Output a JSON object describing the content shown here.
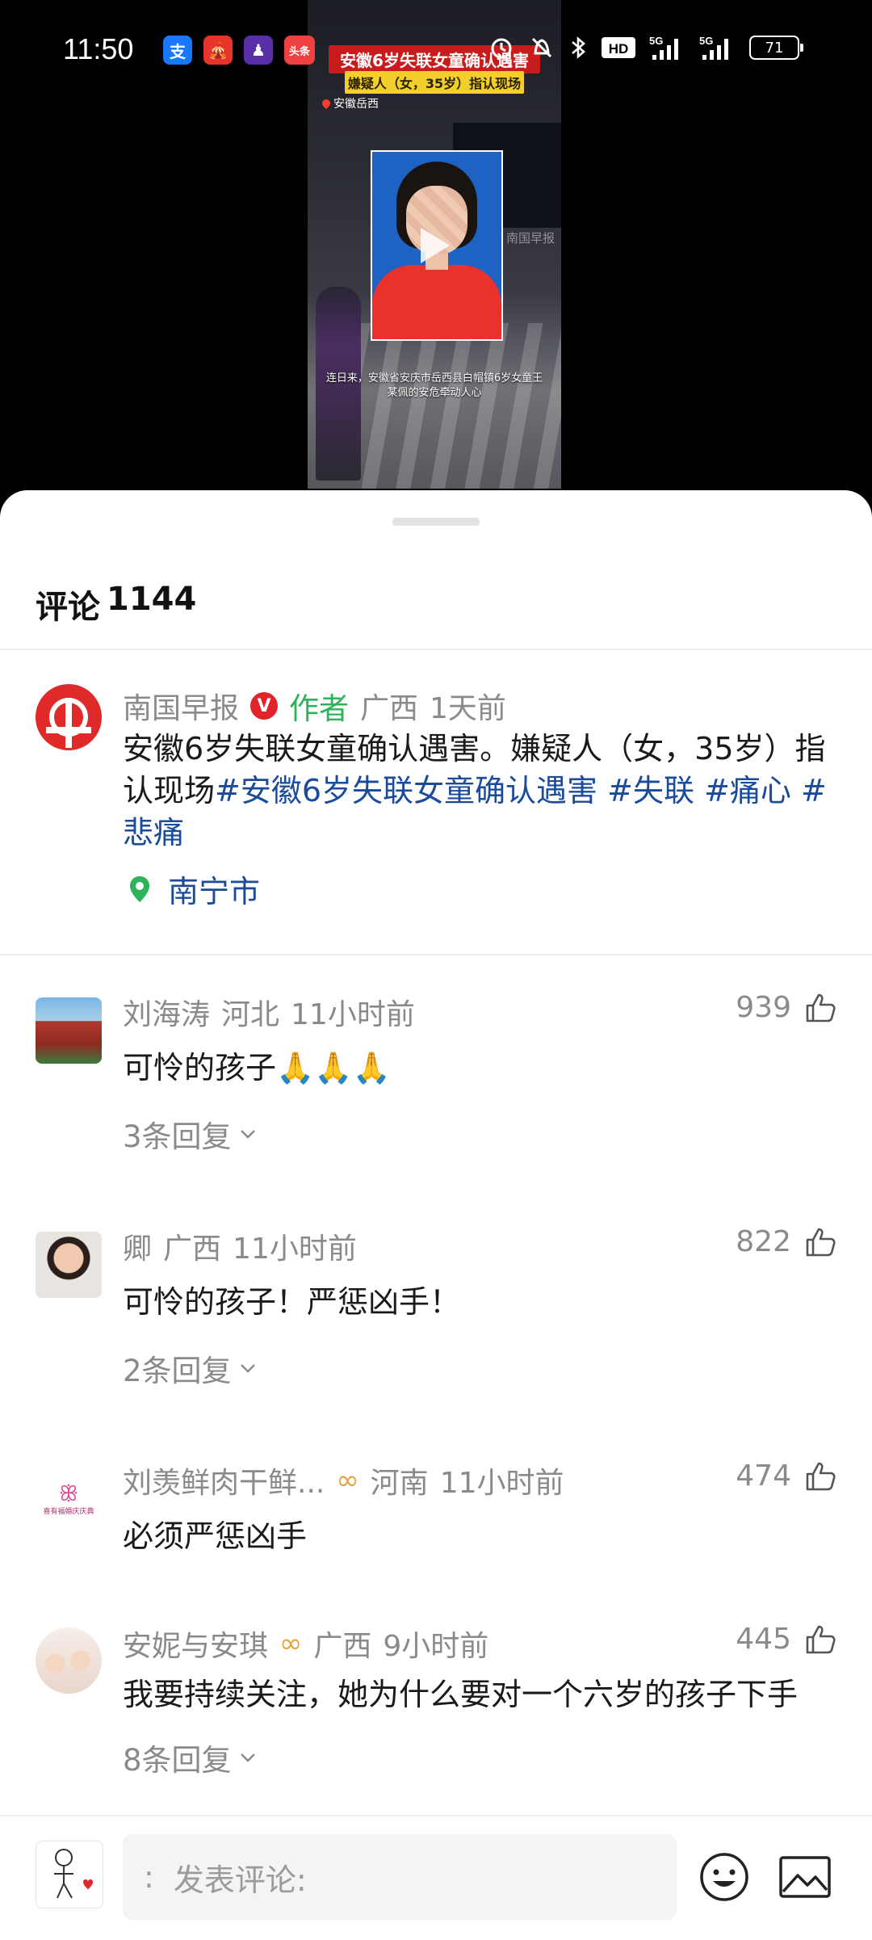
{
  "status_bar": {
    "time": "11:50",
    "apps": [
      "支",
      "🎪",
      "♟",
      "头条"
    ],
    "network_1": "5G",
    "network_2": "5G",
    "hd_label": "HD",
    "battery": "71"
  },
  "video": {
    "title": "安徽6岁失联女童确认遇害",
    "subtitle": "嫌疑人（女，35岁）指认现场",
    "location": "安徽岳西",
    "watermark": "南国早报",
    "caption": "连日来，安徽省安庆市岳西县白帽镇6岁女童王某佩的安危牵动人心"
  },
  "sheet": {
    "title_label": "评论",
    "count": "1144"
  },
  "post": {
    "author": "南国早报",
    "verified_badge": "V",
    "author_tag": "作者",
    "region": "广西",
    "time": "1天前",
    "text": "安徽6岁失联女童确认遇害。嫌疑人（女，35岁）指认现场",
    "hashtags": [
      "#安徽6岁失联女童确认遇害",
      "#失联",
      "#痛心",
      "#悲痛"
    ],
    "location": "南宁市"
  },
  "comments": [
    {
      "user": "刘海涛",
      "region": "河北",
      "time": "11小时前",
      "text": "可怜的孩子🙏🙏🙏",
      "likes": "939",
      "replies": "3条回复"
    },
    {
      "user": "卿",
      "region": "广西",
      "time": "11小时前",
      "text": "可怜的孩子！严惩凶手！",
      "likes": "822",
      "replies": "2条回复"
    },
    {
      "user": "刘羡鲜肉干鲜...",
      "region": "河南",
      "time": "11小时前",
      "text": "必须严惩凶手",
      "likes": "474",
      "avatar_text": "喜有福婚庆庆典"
    },
    {
      "user": "安妮与安琪",
      "region": "广西",
      "time": "9小时前",
      "text": "我要持续关注，她为什么要对一个六岁的孩子下手",
      "likes": "445",
      "replies": "8条回复"
    }
  ],
  "bottom_bar": {
    "input_prefix": ":",
    "input_placeholder": "发表评论:"
  },
  "colors": {
    "author_green": "#2db35a",
    "link_blue": "#1b4b9b",
    "meta_gray": "#8a8a8a",
    "badge_red": "#e0242a"
  }
}
